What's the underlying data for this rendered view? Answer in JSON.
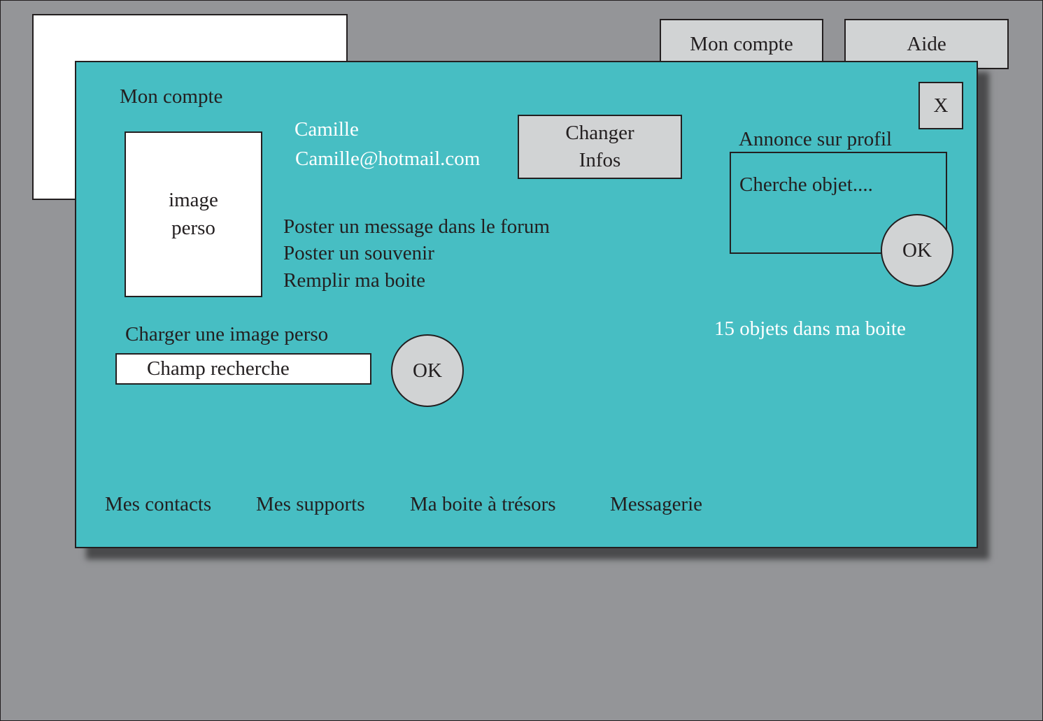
{
  "top_nav": {
    "account_label": "Mon compte",
    "help_label": "Aide"
  },
  "modal": {
    "title": "Mon compte",
    "close_label": "X",
    "user": {
      "name": "Camille",
      "email": "Camille@hotmail.com"
    },
    "change_info_line1": "Changer",
    "change_info_line2": "Infos",
    "avatar_placeholder_line1": "image",
    "avatar_placeholder_line2": "perso",
    "actions": [
      "Poster un message dans le forum",
      "Poster un souvenir",
      "Remplir ma boite"
    ],
    "upload": {
      "label": "Charger une image perso",
      "field_value": "Champ recherche",
      "ok_label": "OK"
    },
    "ad": {
      "label": "Annonce sur profil",
      "text": "Cherche objet....",
      "ok_label": "OK"
    },
    "box_count_text": "15 objets dans ma boite",
    "bottom_nav": [
      "Mes contacts",
      "Mes supports",
      "Ma boite à trésors",
      "Messagerie"
    ]
  },
  "colors": {
    "background": "#949598",
    "modal": "#47bec3",
    "button": "#d1d3d4",
    "stroke": "#231f20"
  }
}
